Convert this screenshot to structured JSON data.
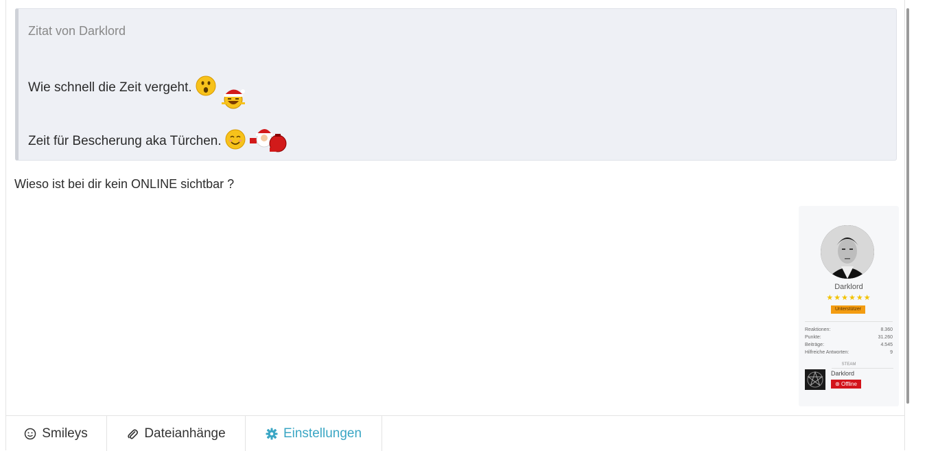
{
  "quote": {
    "title": "Zitat von Darklord",
    "line1": "Wie schnell die Zeit vergeht.",
    "line2": "Zeit für Bescherung aka Türchen."
  },
  "reply": {
    "text": "Wieso ist bei dir kein ONLINE sichtbar ?"
  },
  "profile_card": {
    "name": "Darklord",
    "stars": "★★★★★★",
    "badge": "Unterstützer",
    "stats": [
      {
        "label": "Reaktionen:",
        "value": "8.360"
      },
      {
        "label": "Punkte:",
        "value": "31.260"
      },
      {
        "label": "Beiträge:",
        "value": "4.545"
      },
      {
        "label": "Hilfreiche Antworten:",
        "value": "9"
      }
    ],
    "steam_label": "STEAM",
    "steam_name": "Darklord",
    "steam_status": "Offline"
  },
  "toolbar": {
    "tabs": [
      {
        "label": "Smileys",
        "icon": "smiley-icon"
      },
      {
        "label": "Dateianhänge",
        "icon": "paperclip-icon"
      },
      {
        "label": "Einstellungen",
        "icon": "gear-icon"
      }
    ],
    "active_color": "#3aa6c4"
  }
}
